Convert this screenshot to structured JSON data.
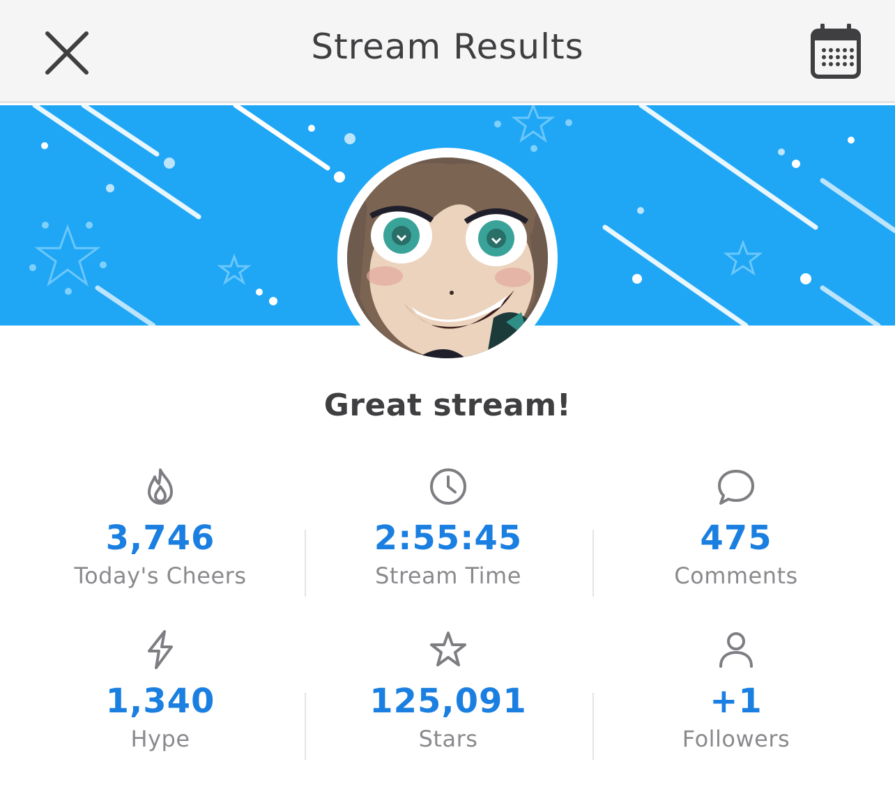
{
  "header": {
    "title": "Stream Results",
    "close_icon": "close-icon",
    "calendar_icon": "calendar-icon"
  },
  "banner": {
    "background_color": "#1fa7f5",
    "decoration": "stars-and-streaks"
  },
  "headline": "Great stream!",
  "accent_color": "#1a7fe0",
  "stats": [
    {
      "icon": "flame-icon",
      "value": "3,746",
      "label": "Today's Cheers"
    },
    {
      "icon": "clock-icon",
      "value": "2:55:45",
      "label": "Stream Time"
    },
    {
      "icon": "comment-icon",
      "value": "475",
      "label": "Comments"
    },
    {
      "icon": "lightning-icon",
      "value": "1,340",
      "label": "Hype"
    },
    {
      "icon": "star-icon",
      "value": "125,091",
      "label": "Stars"
    },
    {
      "icon": "person-icon",
      "value": "+1",
      "label": "Followers"
    }
  ]
}
